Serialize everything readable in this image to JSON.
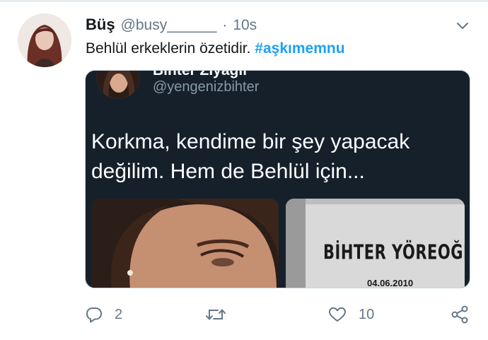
{
  "tweet": {
    "display_name": "Büş",
    "handle": "@busy______",
    "separator": "·",
    "timestamp": "10s",
    "text": "Behlül erkeklerin özetidir.",
    "hashtag": "#aşkımemnu",
    "reply_count": "2",
    "retweet_count": "",
    "like_count": "10"
  },
  "embedded": {
    "name_cut": "Bihter Ziyagil",
    "handle": "@yengenizbihter",
    "text": "Korkma, kendime bir şey yapacak\ndeğilim. Hem de Behlül için...",
    "grave_name": "BİHTER YÖREOĞL",
    "grave_date": "04.06.2010"
  },
  "colors": {
    "accent": "#1da1f2",
    "secondary_text": "#657786",
    "media_background": "#15202b"
  },
  "icons": {
    "caret": "chevron-down-icon",
    "reply": "reply-icon",
    "retweet": "retweet-icon",
    "like": "heart-icon",
    "share": "share-icon"
  }
}
